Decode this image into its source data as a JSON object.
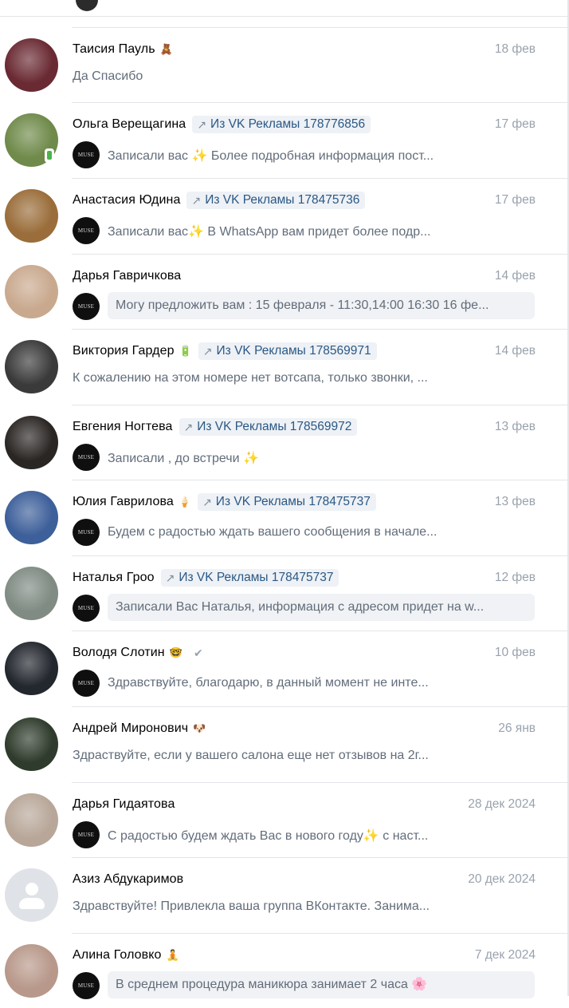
{
  "dialogs": [
    {
      "name": "Таисия Пауль",
      "emoji": "🧸",
      "badge": "",
      "check": "",
      "date": "18 фев",
      "message": "Да Спасибо",
      "msg_style": "plain",
      "avatar_color": "#6a2a33"
    },
    {
      "name": "Ольга Верещагина",
      "emoji": "",
      "badge": "Из VK Рекламы 178776856",
      "check": "",
      "date": "17 фев",
      "message": "Записали вас ✨ Более подробная информация пост...",
      "msg_style": "own",
      "avatar_color": "#6f8a4a",
      "mobile": true
    },
    {
      "name": "Анастасия Юдина",
      "emoji": "",
      "badge": "Из VK Рекламы 178475736",
      "check": "",
      "date": "17 фев",
      "message": "Записали вас✨ В WhatsApp вам придет более подр...",
      "msg_style": "own",
      "avatar_color": "#9a6d3a"
    },
    {
      "name": "Дарья Гавричкова",
      "emoji": "",
      "badge": "",
      "check": "",
      "date": "14 фев",
      "message": "Могу предложить вам : 15 февраля - 11:30,14:00 16:30 16 фе...",
      "msg_style": "unread",
      "avatar_color": "#c9a98e"
    },
    {
      "name": "Виктория Гардер",
      "emoji": "🔋",
      "badge": "Из VK Рекламы 178569971",
      "check": "",
      "date": "14 фев",
      "message": "К сожалению на этом номере нет вотсапа, только звонки, ...",
      "msg_style": "plain",
      "avatar_color": "#3a3a3a"
    },
    {
      "name": "Евгения Ногтева",
      "emoji": "",
      "badge": "Из VK Рекламы 178569972",
      "check": "",
      "date": "13 фев",
      "message": "Записали , до встречи ✨",
      "msg_style": "own",
      "avatar_color": "#2a2624"
    },
    {
      "name": "Юлия Гаврилова",
      "emoji": "🍦",
      "badge": "Из VK Рекламы 178475737",
      "check": "",
      "date": "13 фев",
      "message": "Будем с радостью ждать вашего сообщения в начале...",
      "msg_style": "own",
      "avatar_color": "#3d5f9a"
    },
    {
      "name": "Наталья Гроо",
      "emoji": "",
      "badge": "Из VK Рекламы 178475737",
      "check": "",
      "date": "12 фев",
      "message": "Записали Вас Наталья, информация с адресом придет на w...",
      "msg_style": "unread",
      "avatar_color": "#7f8b83"
    },
    {
      "name": "Володя Слотин",
      "emoji": "🤓",
      "badge": "",
      "check": "✔",
      "date": "10 фев",
      "message": "Здравствуйте, благодарю, в данный момент не инте...",
      "msg_style": "own",
      "avatar_color": "#23272e"
    },
    {
      "name": "Андрей Миронович",
      "emoji": "🐶",
      "badge": "",
      "check": "",
      "date": "26 янв",
      "message": "Здраствуйте, если у вашего салона еще нет отзывов на 2г...",
      "msg_style": "plain",
      "avatar_color": "#2f3b2c"
    },
    {
      "name": "Дарья Гидаятова",
      "emoji": "",
      "badge": "",
      "check": "",
      "date": "28 дек 2024",
      "message": "С радостью будем ждать Вас в нового году✨ с наст...",
      "msg_style": "own",
      "avatar_color": "#b8a799"
    },
    {
      "name": "Азиз Абдукаримов",
      "emoji": "",
      "badge": "",
      "check": "",
      "date": "20 дек 2024",
      "message": "Здравствуйте! Привлекла ваша группа ВКонтакте. Занима...",
      "msg_style": "plain",
      "avatar_color": "",
      "empty_avatar": true
    },
    {
      "name": "Алина Головко",
      "emoji": "🧘",
      "badge": "",
      "check": "",
      "date": "7 дек 2024",
      "message": "В среднем процедура маникюра занимает 2 часа 🌸",
      "msg_style": "unread",
      "avatar_color": "#b8988a"
    }
  ],
  "muse_label": "MUSE",
  "badge_arrow": "↗",
  "colors": {
    "accent": "#2a5885",
    "muted": "#99a2ad",
    "text": "#000000",
    "secondary": "#626d7a",
    "badge_bg": "#eef1f5"
  }
}
